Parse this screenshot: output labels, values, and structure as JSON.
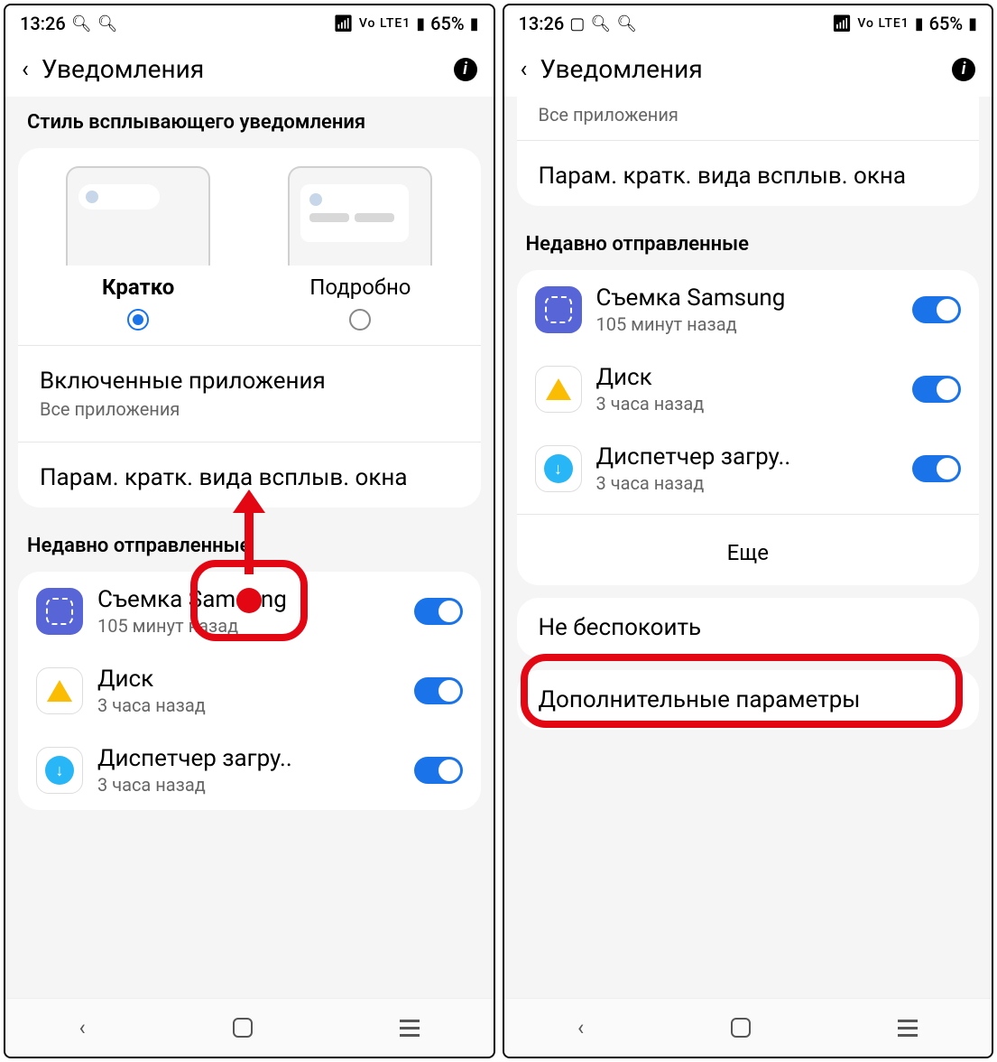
{
  "status": {
    "time": "13:26",
    "battery": "65%",
    "signal_text": "Vo LTE1"
  },
  "header": {
    "title": "Уведомления"
  },
  "left": {
    "style_header": "Стиль всплывающего уведомления",
    "style_brief": "Кратко",
    "style_detailed": "Подробно",
    "enabled_apps_title": "Включенные приложения",
    "enabled_apps_sub": "Все приложения",
    "brief_params": "Парам. кратк. вида всплыв. окна",
    "recent_header": "Недавно отправленные",
    "apps": [
      {
        "name": "Съемка Samsung",
        "time": "105 минут назад"
      },
      {
        "name": "Диск",
        "time": "3 часа назад"
      },
      {
        "name": "Диспетчер загру..",
        "time": "3 часа назад"
      }
    ]
  },
  "right": {
    "all_apps": "Все приложения",
    "brief_params": "Парам. кратк. вида всплыв. окна",
    "recent_header": "Недавно отправленные",
    "apps": [
      {
        "name": "Съемка Samsung",
        "time": "105 минут назад"
      },
      {
        "name": "Диск",
        "time": "3 часа назад"
      },
      {
        "name": "Диспетчер загру..",
        "time": "3 часа назад"
      }
    ],
    "more": "Еще",
    "dnd": "Не беспокоить",
    "advanced": "Дополнительные параметры"
  }
}
